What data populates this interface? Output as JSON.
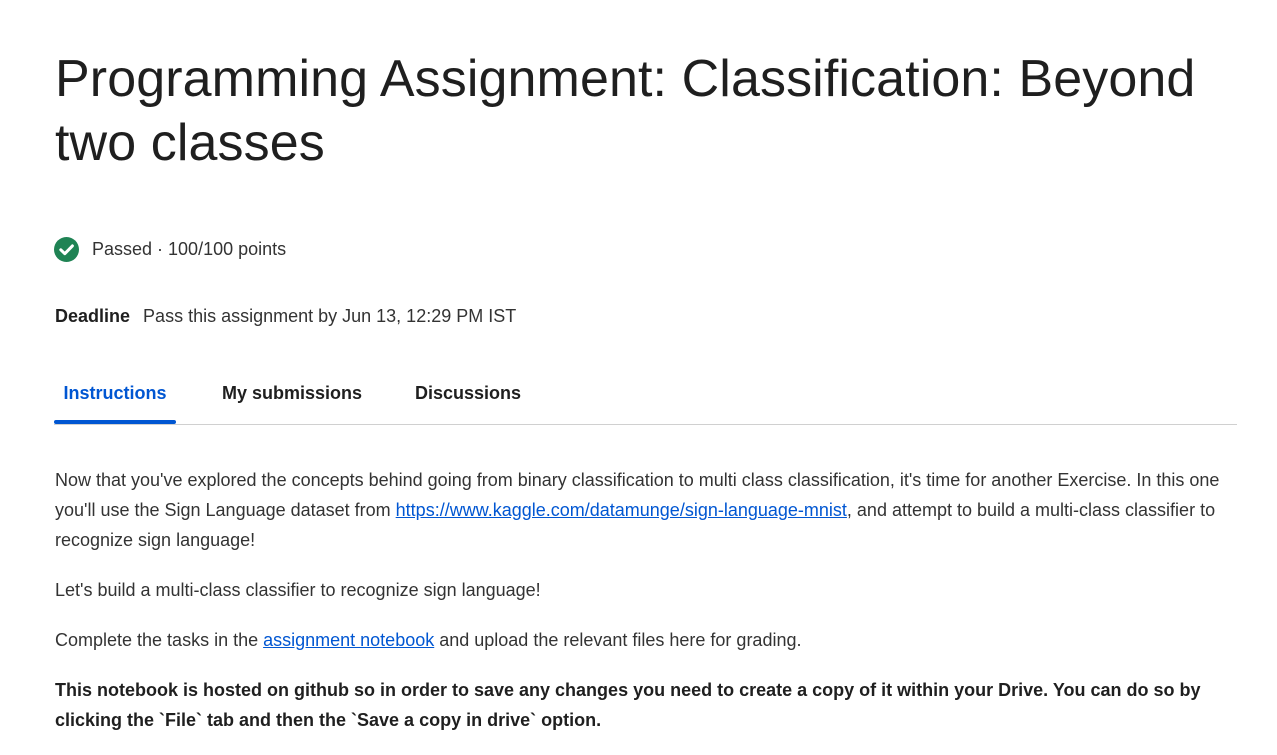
{
  "page_title": "Programming Assignment: Classification: Beyond two classes",
  "status": {
    "icon": "check-circle-icon",
    "color": "#1f8354",
    "text": "Passed · 100/100 points"
  },
  "deadline": {
    "label": "Deadline",
    "text": "Pass this assignment by Jun 13, 12:29 PM IST"
  },
  "tabs": [
    {
      "label": "Instructions",
      "active": true
    },
    {
      "label": "My submissions",
      "active": false
    },
    {
      "label": "Discussions",
      "active": false
    }
  ],
  "accent_color": "#0056d2",
  "instructions": {
    "p1_before": "Now that you've explored the concepts behind going from binary classification to multi class classification, it's time for another Exercise. In this one you'll use the Sign Language dataset from ",
    "p1_link": "https://www.kaggle.com/datamunge/sign-language-mnist",
    "p1_after": ", and attempt to build a multi-class classifier to recognize sign language!",
    "p2": "Let's build a multi-class classifier to recognize sign language!",
    "p3_before": "Complete the tasks in the ",
    "p3_link": "assignment notebook",
    "p3_after": " and upload the relevant files here for grading.",
    "p4": "This notebook is hosted on github so in order to save any changes you need to create a copy of it within your Drive. You can do so by clicking the `File` tab and then the `Save a copy in drive` option."
  }
}
